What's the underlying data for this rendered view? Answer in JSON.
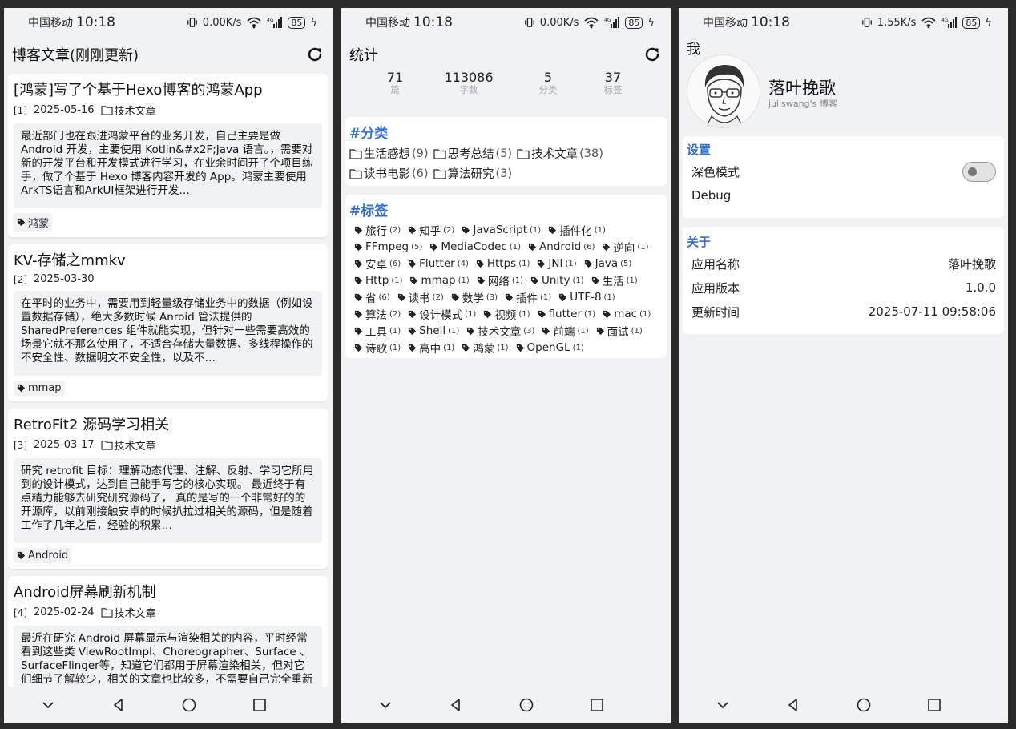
{
  "status": [
    {
      "carrier": "中国移动",
      "time": "10:18",
      "speed": "0.00K/s",
      "battery": "85"
    },
    {
      "carrier": "中国移动",
      "time": "10:18",
      "speed": "0.00K/s",
      "battery": "85"
    },
    {
      "carrier": "中国移动",
      "time": "10:18",
      "speed": "1.55K/s",
      "battery": "85"
    }
  ],
  "blog": {
    "title": "博客文章(刚刚更新)",
    "posts": [
      {
        "title": "[鸿蒙]写了个基于Hexo博客的鸿蒙App",
        "index": "[1]",
        "date": "2025-05-16",
        "category": "技术文章",
        "excerpt": "最近部门也在跟进鸿蒙平台的业务开发，自己主要是做 Android 开发，主要使用 Kotlin&#x2F;Java 语言。，需要对新的开发平台和开发模式进行学习，在业余时间开了个项目练手，做了个基于 Hexo 博客内容开发的 App。鸿蒙主要使用ArkTS语言和ArkUI框架进行开发…",
        "tag": "鸿蒙"
      },
      {
        "title": "KV-存储之mmkv",
        "index": "[2]",
        "date": "2025-03-30",
        "category": "",
        "excerpt": "在平时的业务中，需要用到轻量级存储业务中的数据（例如设置数据存储），绝大多数时候 Anroid 管法提供的 SharedPreferences 组件就能实现，但针对一些需要高效的场景它就不那么使用了，不适合存储大量数据、多线程操作的不安全性、数据明文不安全性，以及不…",
        "tag": "mmap"
      },
      {
        "title": "RetroFit2 源码学习相关",
        "index": "[3]",
        "date": "2025-03-17",
        "category": "技术文章",
        "excerpt": "研究 retrofit 目标：理解动态代理、注解、反射、学习它所用到的设计模式，达到自己能手写它的核心实现。 最近终于有点精力能够去研究研究源码了， 真的是写的一个非常好的的开源库，以前刚接触安卓的时候扒拉过相关的源码，但是随着工作了几年之后，经验的积累…",
        "tag": "Android"
      },
      {
        "title": "Android屏幕刷新机制",
        "index": "[4]",
        "date": "2025-02-24",
        "category": "技术文章",
        "excerpt": "最近在研究 Android 屏幕显示与渲染相关的内容，平时经常看到这些类 ViewRootImpl、Choreographer、Surface 、 SurfaceFlinger等，知道它们都用于屏幕渲染相关，但对它们细节了解较少，相关的文章也比较多，不需要自己完全重新再编写一份，于是对相关内容进…",
        "tag": ""
      }
    ]
  },
  "stats": {
    "title": "统计",
    "items": [
      {
        "num": "71",
        "label": "篇"
      },
      {
        "num": "113086",
        "label": "字数"
      },
      {
        "num": "5",
        "label": "分类"
      },
      {
        "num": "37",
        "label": "标签"
      }
    ],
    "categories_title": "#分类",
    "categories": [
      {
        "name": "生活感想",
        "count": "(9)"
      },
      {
        "name": "思考总结",
        "count": "(5)"
      },
      {
        "name": "技术文章",
        "count": "(38)"
      },
      {
        "name": "读书电影",
        "count": "(6)"
      },
      {
        "name": "算法研究",
        "count": "(3)"
      }
    ],
    "tags_title": "#标签",
    "tags": [
      {
        "name": "旅行",
        "count": "(2)"
      },
      {
        "name": "知乎",
        "count": "(2)"
      },
      {
        "name": "JavaScript",
        "count": "(1)"
      },
      {
        "name": "插件化",
        "count": "(1)"
      },
      {
        "name": "FFmpeg",
        "count": "(5)"
      },
      {
        "name": "MediaCodec",
        "count": "(1)"
      },
      {
        "name": "Android",
        "count": "(6)"
      },
      {
        "name": "逆向",
        "count": "(1)"
      },
      {
        "name": "安卓",
        "count": "(6)"
      },
      {
        "name": "Flutter",
        "count": "(4)"
      },
      {
        "name": "Https",
        "count": "(1)"
      },
      {
        "name": "JNI",
        "count": "(1)"
      },
      {
        "name": "Java",
        "count": "(5)"
      },
      {
        "name": "Http",
        "count": "(1)"
      },
      {
        "name": "mmap",
        "count": "(1)"
      },
      {
        "name": "网络",
        "count": "(1)"
      },
      {
        "name": "Unity",
        "count": "(1)"
      },
      {
        "name": "生活",
        "count": "(1)"
      },
      {
        "name": "省",
        "count": "(6)"
      },
      {
        "name": "读书",
        "count": "(2)"
      },
      {
        "name": "数学",
        "count": "(3)"
      },
      {
        "name": "插件",
        "count": "(1)"
      },
      {
        "name": "UTF-8",
        "count": "(1)"
      },
      {
        "name": "算法",
        "count": "(2)"
      },
      {
        "name": "设计模式",
        "count": "(1)"
      },
      {
        "name": "视频",
        "count": "(1)"
      },
      {
        "name": "flutter",
        "count": "(1)"
      },
      {
        "name": "mac",
        "count": "(1)"
      },
      {
        "name": "工具",
        "count": "(1)"
      },
      {
        "name": "Shell",
        "count": "(1)"
      },
      {
        "name": "技术文章",
        "count": "(3)"
      },
      {
        "name": "前端",
        "count": "(1)"
      },
      {
        "name": "面试",
        "count": "(1)"
      },
      {
        "name": "诗歌",
        "count": "(1)"
      },
      {
        "name": "高中",
        "count": "(1)"
      },
      {
        "name": "鸿蒙",
        "count": "(1)"
      },
      {
        "name": "OpenGL",
        "count": "(1)"
      }
    ]
  },
  "me": {
    "title": "我",
    "name": "落叶挽歌",
    "subtitle": "juliswang's 博客",
    "settings_title": "设置",
    "dark_mode_label": "深色模式",
    "dark_mode_on": false,
    "debug_label": "Debug",
    "about_title": "关于",
    "about": [
      {
        "label": "应用名称",
        "value": "落叶挽歌"
      },
      {
        "label": "应用版本",
        "value": "1.0.0"
      },
      {
        "label": "更新时间",
        "value": "2025-07-11 09:58:06"
      }
    ]
  },
  "colors": {
    "accent": "#2f6fd6",
    "background": "#f1f2f4",
    "card": "#ffffff"
  }
}
